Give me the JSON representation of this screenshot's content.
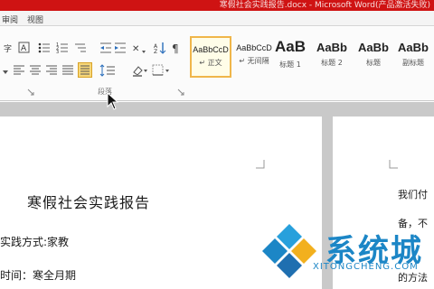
{
  "window": {
    "title": "寒假社会实践报告.docx - Microsoft Word(产品激活失败)"
  },
  "menu": {
    "items": [
      "审阅",
      "视图"
    ]
  },
  "ribbon": {
    "paragraph_group_label": "段落",
    "styles": [
      {
        "sample": "AaBbCcD",
        "name": "↵ 正文",
        "active": true
      },
      {
        "sample": "AaBbCcD",
        "name": "↵ 无间隔",
        "active": false
      },
      {
        "sample": "AaB",
        "name": "标题 1",
        "active": false
      },
      {
        "sample": "AaBb",
        "name": "标题 2",
        "active": false
      },
      {
        "sample": "AaBb",
        "name": "标题",
        "active": false
      },
      {
        "sample": "AaBb",
        "name": "副标题",
        "active": false
      }
    ]
  },
  "document": {
    "page1": {
      "title": "寒假社会实践报告",
      "line1": "实践方式:家教",
      "line2": "时间：寒全月期"
    },
    "page2": {
      "line1": "我们付",
      "line2": "备，不",
      "line3": "的方法"
    }
  },
  "watermark": {
    "text": "系统城",
    "sub": "XITONGCHENG.COM"
  },
  "colors": {
    "title_bar": "#cf1313",
    "style_active_border": "#f0b64a",
    "watermark_blue": "#1c86c6"
  }
}
